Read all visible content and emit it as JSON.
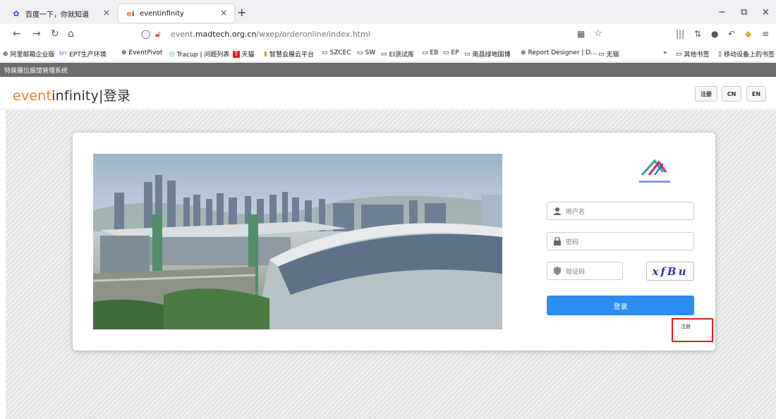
{
  "browser": {
    "tabs": [
      {
        "title": "百度一下，你就知道",
        "icon": "baidu-paw-icon"
      },
      {
        "title": "eventinfinity",
        "icon": "ei-logo-icon",
        "active": true
      }
    ],
    "new_tab": "+",
    "window_controls": {
      "minimize": "−",
      "restore": "⧉",
      "close": "×"
    },
    "url": {
      "host_prefix": "event.",
      "host_main": "madtech.org.cn",
      "path": "/wxep/orderonline/index.html"
    },
    "bookmarks": [
      {
        "label": "阿里邮箱企业版",
        "icon": "globe-icon"
      },
      {
        "label": "EPT生产环境",
        "icon": "ept-icon"
      },
      {
        "label": "EventPivot",
        "icon": "globe-icon"
      },
      {
        "label": "Tracup | 问题列表",
        "icon": "tracup-icon"
      },
      {
        "label": "天猫",
        "icon": "tmall-icon"
      },
      {
        "label": "智慧会展云平台",
        "icon": "cloud-icon"
      },
      {
        "label": "SZCEC",
        "icon": "folder-icon"
      },
      {
        "label": "SW",
        "icon": "folder-icon"
      },
      {
        "label": "EI测试库",
        "icon": "folder-icon"
      },
      {
        "label": "EB",
        "icon": "folder-icon"
      },
      {
        "label": "EP",
        "icon": "folder-icon"
      },
      {
        "label": "南昌绿地国博",
        "icon": "folder-icon"
      },
      {
        "label": "Report Designer | D...",
        "icon": "globe-icon"
      },
      {
        "label": "无锡",
        "icon": "folder-icon"
      }
    ],
    "bookmarks_overflow": "»",
    "other_bookmarks": "其他书签",
    "mobile_bookmarks": "移动设备上的书签"
  },
  "page": {
    "system_name": "特装展位报馆管理系统",
    "logo": {
      "part1": "event",
      "part2": "infinity",
      "suffix": "|登录"
    },
    "header_buttons": {
      "register": "注册",
      "cn": "CN",
      "en": "EN"
    },
    "login": {
      "username_placeholder": "用户名",
      "password_placeholder": "密码",
      "captcha_placeholder": "验证码",
      "captcha_text": "xfBu",
      "login_button": "登录",
      "register_link": "注册"
    }
  },
  "colors": {
    "accent": "#2d8cf0",
    "logo_orange": "#e87c2c",
    "highlight": "#e02020"
  }
}
